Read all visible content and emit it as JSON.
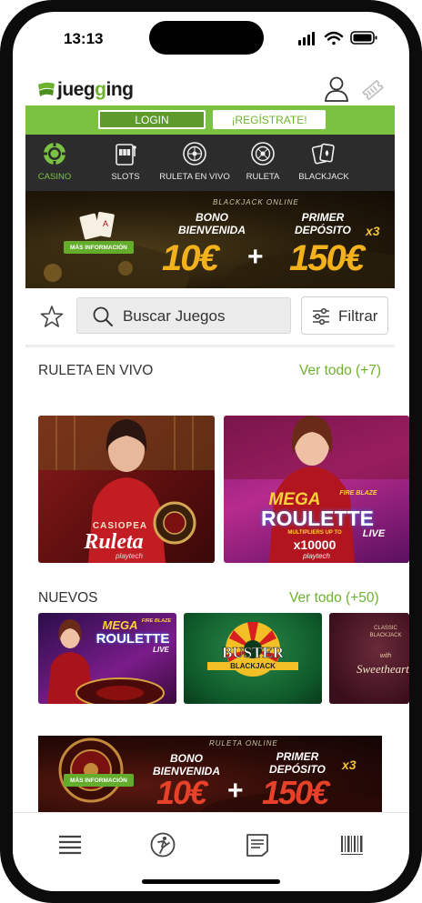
{
  "status": {
    "time": "13:13"
  },
  "header": {
    "logo_prefix": "jueg",
    "logo_mid": "g",
    "logo_suffix": "ing"
  },
  "auth": {
    "login": "LOGIN",
    "register": "¡REGÍSTRATE!"
  },
  "categories": [
    {
      "label": "CASINO",
      "icon": "casino-chip-icon",
      "active": true
    },
    {
      "label": "SLOTS",
      "icon": "slot-machine-icon",
      "active": false
    },
    {
      "label": "RULETA EN VIVO",
      "icon": "roulette-live-icon",
      "active": false
    },
    {
      "label": "RULETA",
      "icon": "roulette-icon",
      "active": false
    },
    {
      "label": "BLACKJACK",
      "icon": "cards-icon",
      "active": false
    }
  ],
  "banner_blackjack": {
    "eyebrow": "BLACKJACK ONLINE",
    "more_info": "MÁS INFORMACIÓN",
    "bono_line1": "BONO",
    "bono_line2": "BIENVENIDA",
    "dep_line1": "PRIMER",
    "dep_line2": "DEPÓSITO",
    "multiplier": "x3",
    "amount1": "10€",
    "plus": "+",
    "amount2": "150€"
  },
  "search": {
    "placeholder": "Buscar Juegos",
    "filter_label": "Filtrar"
  },
  "section_live": {
    "title": "RULETA EN VIVO",
    "link": "Ver todo (+7)",
    "tiles": [
      {
        "line1": "CASIOPEA",
        "line2": "Ruleta",
        "brand": "playtech"
      },
      {
        "line1": "MEGA",
        "line1b": "FIRE BLAZE",
        "line2": "ROULETTE",
        "line3": "LIVE",
        "extra": "MULTIPLIERS UP TO",
        "multiplier": "x10000",
        "brand": "playtech"
      }
    ]
  },
  "section_new": {
    "title": "NUEVOS",
    "link": "Ver todo (+50)",
    "tiles": [
      {
        "line1": "MEGA",
        "line1b": "FIRE BLAZE",
        "line2": "ROULETTE",
        "line3": "LIVE"
      },
      {
        "line1": "BUSTER",
        "line2": "BLACKJACK"
      },
      {
        "line1": "CLASSIC",
        "line1b": "BLACKJACK",
        "line2": "with",
        "line3": "Sweethearts"
      }
    ]
  },
  "banner_ruleta": {
    "eyebrow": "RULETA ONLINE",
    "more_info": "MÁS INFORMACIÓN",
    "bono_line1": "BONO",
    "bono_line2": "BIENVENIDA",
    "dep_line1": "PRIMER",
    "dep_line2": "DEPÓSITO",
    "multiplier": "x3",
    "amount1": "10€",
    "plus": "+",
    "amount2": "150€"
  },
  "nav": [
    {
      "icon": "menu-icon"
    },
    {
      "icon": "sports-icon"
    },
    {
      "icon": "bet-slip-icon"
    },
    {
      "icon": "barcode-icon"
    }
  ],
  "colors": {
    "brand_green": "#6db22e",
    "auth_bar": "#7cc242",
    "category_bar": "#2c2c2c",
    "gold": "#f3b21c"
  }
}
